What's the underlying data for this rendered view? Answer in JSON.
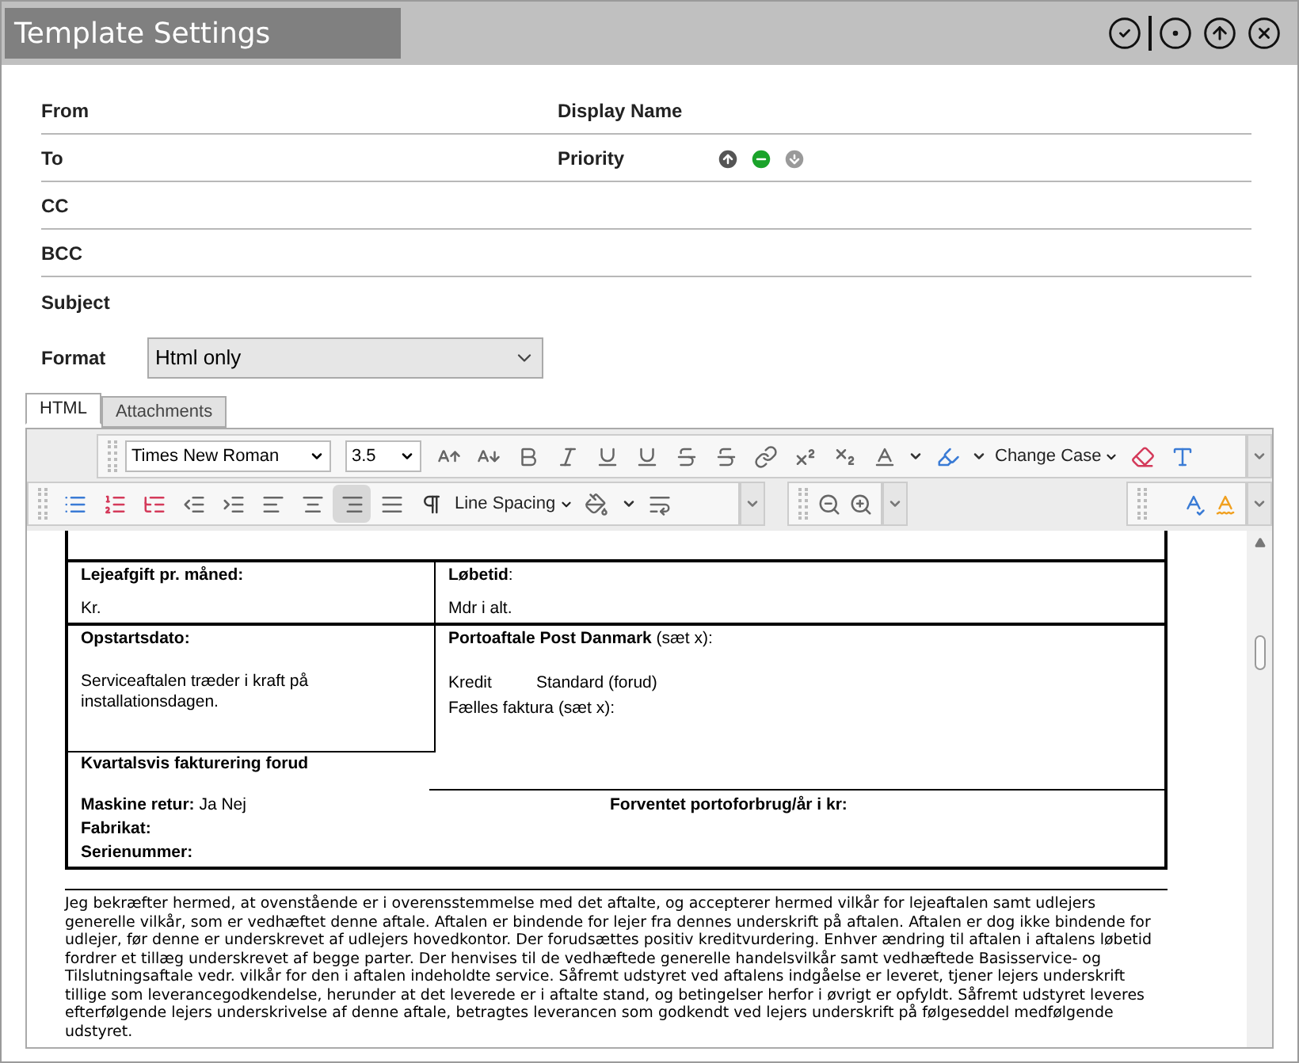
{
  "window": {
    "title": "Template Settings"
  },
  "fields": [
    {
      "label": "From"
    },
    {
      "label": "To"
    },
    {
      "label": "CC"
    },
    {
      "label": "BCC"
    },
    {
      "label": "Subject"
    }
  ],
  "display_name": {
    "label": "Display Name"
  },
  "priority": {
    "label": "Priority",
    "options": [
      {
        "kind": "high",
        "selected": false
      },
      {
        "kind": "normal",
        "selected": true
      },
      {
        "kind": "low",
        "selected": false
      }
    ]
  },
  "format": {
    "label": "Format",
    "value": "Html only"
  },
  "tabs": [
    {
      "label": "HTML",
      "selected": true
    },
    {
      "label": "Attachments",
      "selected": false
    }
  ],
  "toolbar": {
    "font": "Times New Roman",
    "size": "3.5",
    "change_case": "Change Case",
    "line_spacing": "Line Spacing"
  },
  "document": {
    "lease_fee": {
      "label": "Lejeafgift pr. måned:",
      "value": "Kr."
    },
    "term": {
      "label": "**Løbetid**:",
      "value": "Mdr i alt."
    },
    "start_date": {
      "label": "Opstartsdato:",
      "value": "Serviceaftalen træder i kraft på installationsdagen."
    },
    "postage": {
      "label": "**Portoaftale Post Danmark** (sæt x):",
      "options": [
        "Kredit",
        "Standard (forud)"
      ],
      "joint_invoice": "Fælles faktura (sæt x):"
    },
    "quarterly": "Kvartalsvis fakturering forud",
    "machine_return": "**Maskine retur:** Ja Nej",
    "make": "Fabrikat:",
    "serial": "Serienummer:",
    "expected_postage": "Forventet portoforbrug/år i kr:",
    "terms": "Jeg bekræfter hermed, at ovenstående er i overensstemmelse med det aftalte, og accepterer hermed vilkår for lejeaftalen samt udlejers generelle vilkår, som er vedhæftet denne aftale. Aftalen er bindende for lejer fra dennes underskrift på aftalen. Aftalen er dog ikke bindende for udlejer, før denne er underskrevet af udlejers hovedkontor. Der forudsættes positiv kreditvurdering. Enhver ændring til aftalen i aftalens løbetid fordrer et tillæg underskrevet af begge parter. Der henvises til de vedhæftede generelle handelsvilkår samt vedhæftede Basisservice- og Tilslutningsaftale vedr. vilkår for den i aftalen indeholdte service. Såfremt udstyret ved aftalens indgåelse er leveret, tjener lejers underskrift tillige som leverancegodkendelse, herunder at det leverede er i aftalte stand, og betingelser herfor i øvrigt er opfyldt. Såfremt udstyret leveres efterfølgende lejers underskrivelse af denne aftale, betragtes leverancen som godkendt ved lejers underskrift på følgeseddel medfølgende udstyret."
  }
}
